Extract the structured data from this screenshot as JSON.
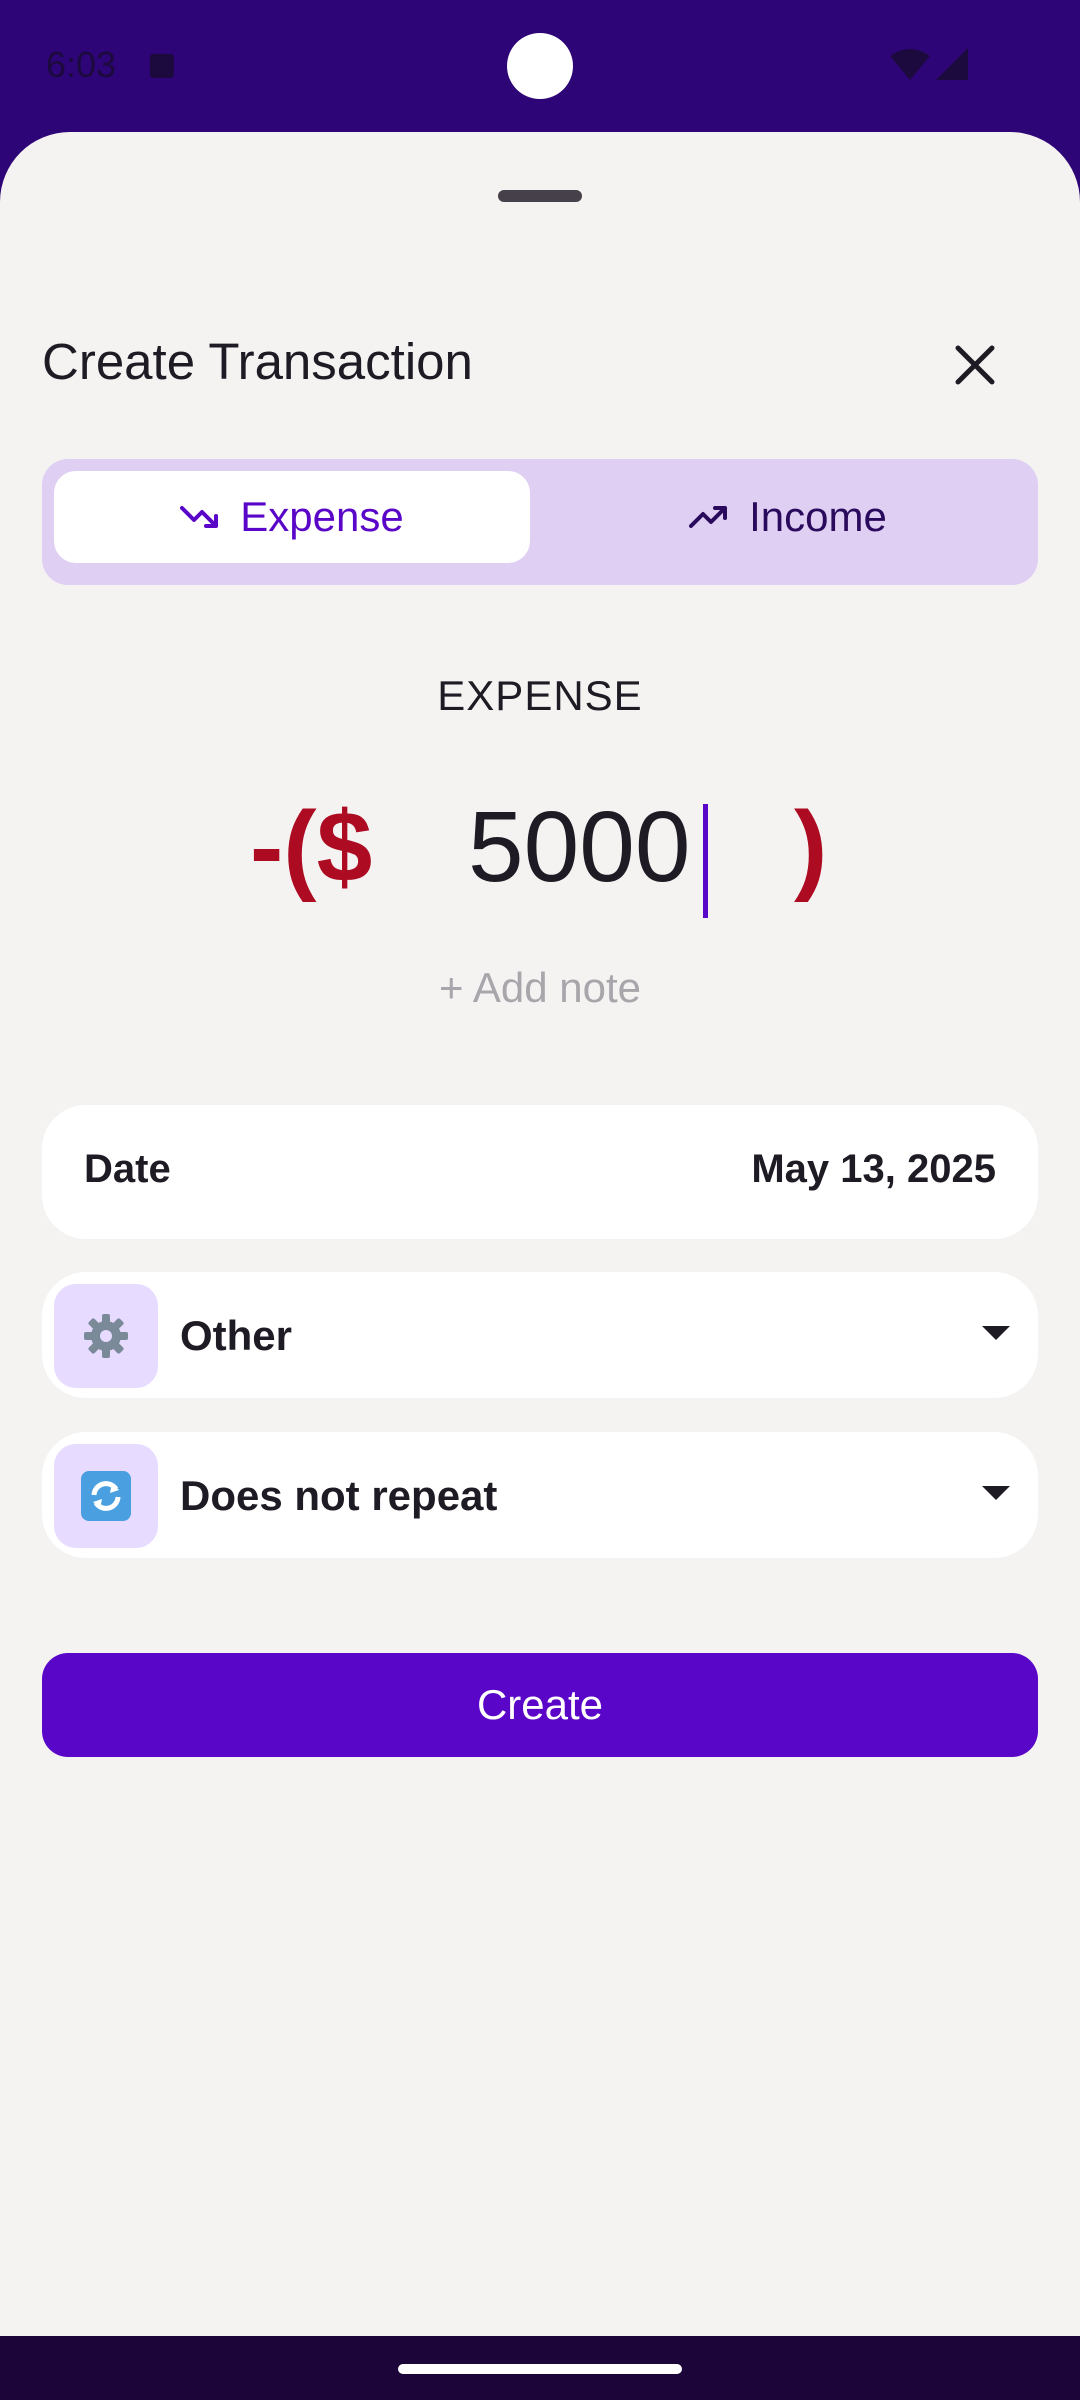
{
  "status_bar": {
    "time": "6:03",
    "icons": [
      "notification-a-icon",
      "wifi-icon",
      "signal-icon"
    ]
  },
  "sheet": {
    "title": "Create Transaction",
    "close_icon": "close-icon"
  },
  "type_toggle": {
    "options": [
      {
        "label": "Expense",
        "icon": "trending-down-icon",
        "selected": true
      },
      {
        "label": "Income",
        "icon": "trending-up-icon",
        "selected": false
      }
    ]
  },
  "amount": {
    "type_label": "EXPENSE",
    "prefix": "-($",
    "value": "5000",
    "suffix": ")"
  },
  "add_note_label": "+ Add note",
  "date": {
    "label": "Date",
    "value": "May 13, 2025"
  },
  "category": {
    "icon": "gear-icon",
    "glyph": "⚙️",
    "label": "Other"
  },
  "repeat": {
    "icon": "repeat-icon",
    "glyph": "🔄",
    "label": "Does not repeat"
  },
  "create_button_label": "Create",
  "colors": {
    "accent": "#5a06c8",
    "expense_red": "#ac0b22",
    "toggle_bg": "#dfcff3",
    "header_purple": "#2e0577",
    "sheet_bg": "#f5f3f2"
  }
}
